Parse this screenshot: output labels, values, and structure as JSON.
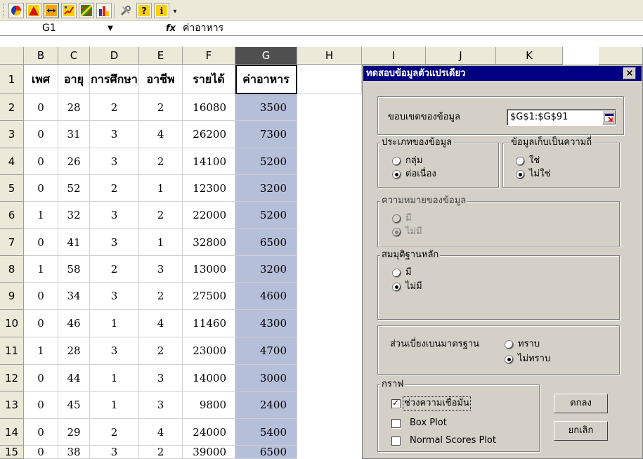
{
  "toolbar": {
    "icons": [
      "pie-chart-icon",
      "mountain-chart-icon",
      "line-arrows-icon",
      "scatter-icon",
      "pattern-icon",
      "bar-chart-icon",
      "tools-icon",
      "help-icon",
      "info-icon"
    ]
  },
  "formula_bar": {
    "name_box": "G1",
    "fx": "fx",
    "formula": "ค่าอาหาร"
  },
  "grid": {
    "columns": [
      "B",
      "C",
      "D",
      "E",
      "F",
      "G",
      "H",
      "I",
      "J",
      "K"
    ],
    "rows": [
      {
        "num": "1",
        "cells": [
          "เพศ",
          "อายุ",
          "การศึกษา",
          "อาชีพ",
          "รายได้",
          "ค่าอาหาร"
        ]
      },
      {
        "num": "2",
        "cells": [
          "0",
          "28",
          "2",
          "2",
          "16080",
          "3500"
        ]
      },
      {
        "num": "3",
        "cells": [
          "0",
          "31",
          "3",
          "4",
          "26200",
          "7300"
        ]
      },
      {
        "num": "4",
        "cells": [
          "0",
          "26",
          "3",
          "2",
          "14100",
          "5200"
        ]
      },
      {
        "num": "5",
        "cells": [
          "0",
          "52",
          "2",
          "1",
          "12300",
          "3200"
        ]
      },
      {
        "num": "6",
        "cells": [
          "1",
          "32",
          "3",
          "2",
          "22000",
          "5200"
        ]
      },
      {
        "num": "7",
        "cells": [
          "0",
          "41",
          "3",
          "1",
          "32800",
          "6500"
        ]
      },
      {
        "num": "8",
        "cells": [
          "1",
          "58",
          "2",
          "3",
          "13000",
          "3200"
        ]
      },
      {
        "num": "9",
        "cells": [
          "0",
          "34",
          "3",
          "2",
          "27500",
          "4600"
        ]
      },
      {
        "num": "10",
        "cells": [
          "0",
          "46",
          "1",
          "4",
          "11460",
          "4300"
        ]
      },
      {
        "num": "11",
        "cells": [
          "1",
          "28",
          "3",
          "2",
          "23000",
          "4700"
        ]
      },
      {
        "num": "12",
        "cells": [
          "0",
          "44",
          "1",
          "3",
          "14000",
          "3000"
        ]
      },
      {
        "num": "13",
        "cells": [
          "0",
          "45",
          "1",
          "3",
          "9800",
          "2400"
        ]
      },
      {
        "num": "14",
        "cells": [
          "0",
          "29",
          "2",
          "4",
          "24000",
          "5400"
        ]
      },
      {
        "num": "15",
        "cells": [
          "0",
          "38",
          "3",
          "2",
          "39000",
          "6500"
        ]
      }
    ]
  },
  "dialog": {
    "title": "ทดสอบข้อมูลตัวแปรเดียว",
    "close": "×",
    "range_label": "ขอบเขตของข้อมูล",
    "range_value": "$G$1:$G$91",
    "data_type": {
      "label": "ประเภทของข้อมูล",
      "options": [
        "กลุ่ม",
        "ต่อเนื่อง"
      ],
      "selected": "ต่อเนื่อง"
    },
    "frequency": {
      "label": "ข้อมูลเก็บเป็นความถี่",
      "options": [
        "ใช่",
        "ไม่ใช่"
      ],
      "selected": "ไม่ใช่"
    },
    "meaning": {
      "label": "ความหมายของข้อมูล",
      "options": [
        "มี",
        "ไม่มี"
      ],
      "selected": "ไม่มี",
      "disabled": true
    },
    "hypothesis": {
      "label": "สมมุติฐานหลัก",
      "options": [
        "มี",
        "ไม่มี"
      ],
      "selected": "ไม่มี"
    },
    "stddev": {
      "label": "ส่วนเบี่ยงเบนมาตรฐาน",
      "options": [
        "ทราบ",
        "ไม่ทราบ"
      ],
      "selected": "ไม่ทราบ"
    },
    "graph": {
      "label": "กราฟ",
      "checkboxes": [
        {
          "label": "ช่วงความเชื่อมั่น",
          "checked": true
        },
        {
          "label": "Box Plot",
          "checked": false
        },
        {
          "label": "Normal Scores Plot",
          "checked": false
        }
      ]
    },
    "ok_label": "ตกลง",
    "cancel_label": "ยกเลิก"
  }
}
